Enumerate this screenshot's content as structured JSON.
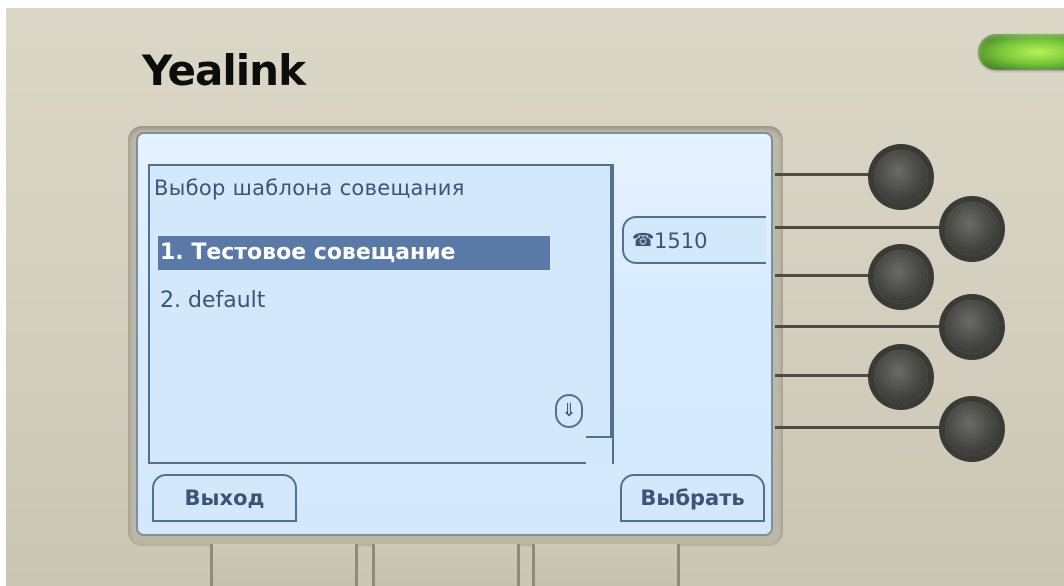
{
  "brand": {
    "logo_text": "Yealink"
  },
  "screen": {
    "title": "Выбор шаблона совещания",
    "items": [
      {
        "label": "1. Тестовое совещание",
        "selected": true
      },
      {
        "label": "2. default",
        "selected": false
      }
    ],
    "scroll_icon": "arrow-down-icon",
    "line_key": {
      "icon": "phone-icon",
      "label": "1510"
    },
    "softkeys": {
      "left": "Выход",
      "right": "Выбрать"
    }
  },
  "colors": {
    "screen_bg": "#d4e8fc",
    "text": "#3c5577",
    "selection": "#5a79a7",
    "led": "#79c73a"
  }
}
